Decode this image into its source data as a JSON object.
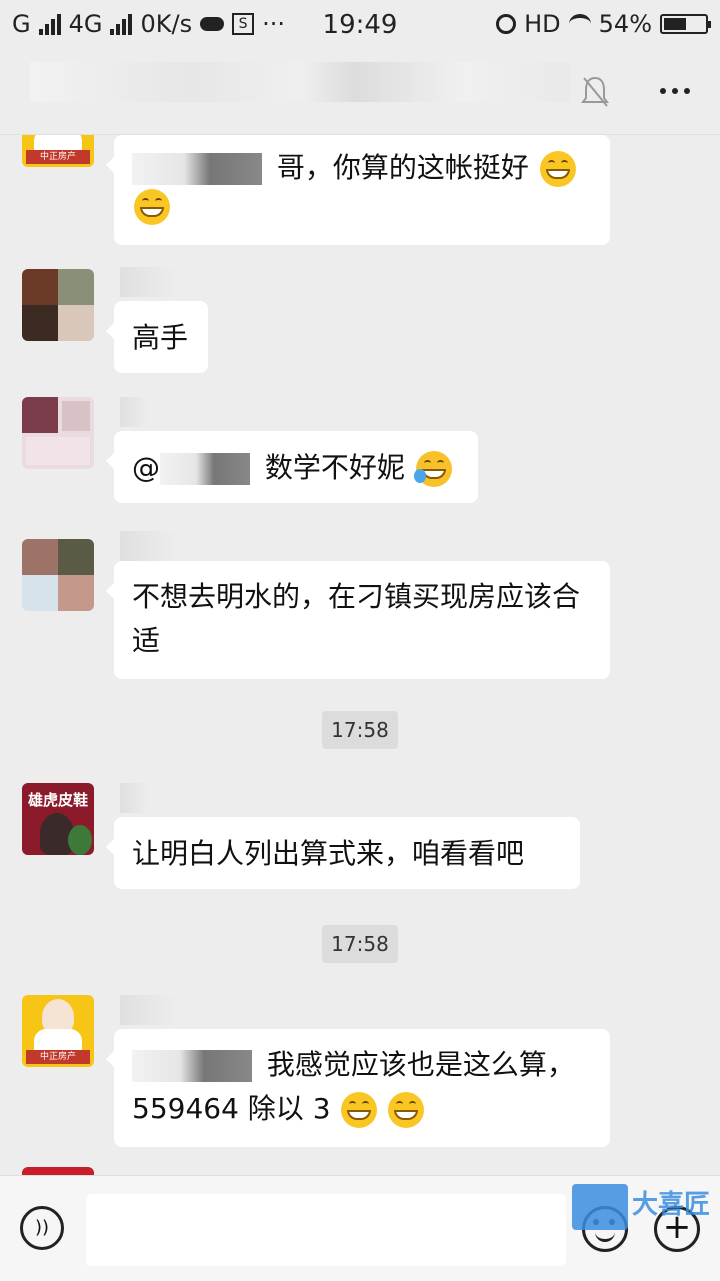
{
  "statusbar": {
    "carrier1": "G",
    "carrier2": "4G",
    "speed": "0K/s",
    "time": "19:49",
    "hd": "HD",
    "battery": "54%",
    "battery_level": 0.54
  },
  "navbar": {
    "bell_icon": "bell-muted-icon",
    "more_icon": "more-dots-icon"
  },
  "messages": [
    {
      "text": "哥，你算的这帐挺好",
      "emoji": [
        "grin",
        "grin"
      ]
    },
    {
      "text": "高手"
    },
    {
      "prefix": "@",
      "text": "数学不好妮",
      "emoji": [
        "laugh-cry"
      ]
    },
    {
      "text": "不想去明水的，在刁镇买现房应该合适"
    },
    {
      "text": "让明白人列出算式来，咱看看吧"
    },
    {
      "text": "我感觉应该也是这么算，559464 除以 3",
      "emoji": [
        "grin",
        "grin"
      ]
    }
  ],
  "timestamps": [
    "17:58",
    "17:58"
  ],
  "avatars": {
    "a1_label": "中正房产",
    "shoe_brand": "雄虎皮鞋"
  },
  "inputbar": {
    "voice_icon": "voice-icon",
    "emoji_icon": "emoji-icon",
    "plus_icon": "plus-icon",
    "watermark": "大喜匠"
  }
}
